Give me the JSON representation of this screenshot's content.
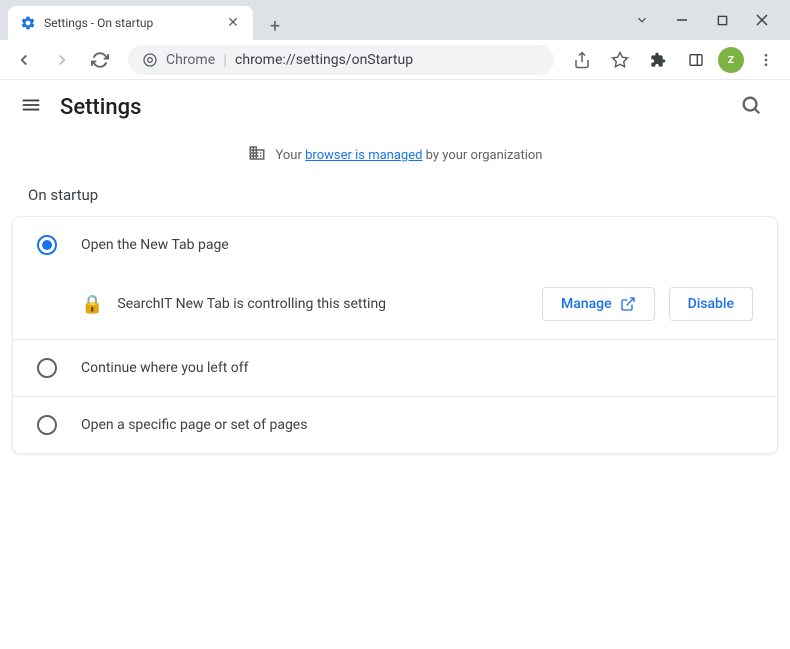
{
  "window": {
    "tab_title": "Settings - On startup"
  },
  "toolbar": {
    "url_prefix": "Chrome",
    "url_path": "chrome://settings/onStartup",
    "avatar_initial": "z"
  },
  "settings": {
    "title": "Settings",
    "managed_prefix": "Your ",
    "managed_link": "browser is managed",
    "managed_suffix": " by your organization",
    "section_title": "On startup",
    "options": [
      {
        "label": "Open the New Tab page",
        "selected": true
      },
      {
        "label": "Continue where you left off",
        "selected": false
      },
      {
        "label": "Open a specific page or set of pages",
        "selected": false
      }
    ],
    "extension_notice": "SearchIT New Tab is controlling this setting",
    "manage_label": "Manage",
    "disable_label": "Disable"
  }
}
